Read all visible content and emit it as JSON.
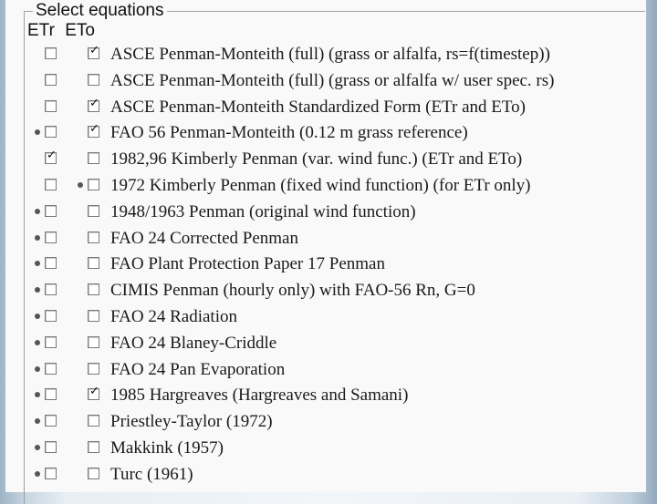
{
  "group": {
    "title": "Select equations",
    "col_etr": "ETr",
    "col_eto": "ETo"
  },
  "equations": [
    {
      "label": "ASCE Penman-Monteith (full) (grass or alfalfa, rs=f(timestep))",
      "etr_checked": false,
      "eto_checked": true,
      "etr_dot": false,
      "eto_dot": false
    },
    {
      "label": "ASCE Penman-Monteith (full) (grass or alfalfa w/ user spec. rs)",
      "etr_checked": false,
      "eto_checked": false,
      "etr_dot": false,
      "eto_dot": false
    },
    {
      "label": "ASCE Penman-Monteith Standardized Form (ETr and ETo)",
      "etr_checked": false,
      "eto_checked": true,
      "etr_dot": false,
      "eto_dot": false
    },
    {
      "label": "FAO 56 Penman-Monteith (0.12 m grass reference)",
      "etr_checked": false,
      "eto_checked": true,
      "etr_dot": true,
      "eto_dot": false
    },
    {
      "label": "1982,96 Kimberly Penman (var. wind func.) (ETr and ETo)",
      "etr_checked": true,
      "eto_checked": false,
      "etr_dot": false,
      "eto_dot": false
    },
    {
      "label": "1972 Kimberly Penman (fixed wind function) (for ETr only)",
      "etr_checked": false,
      "eto_checked": false,
      "etr_dot": false,
      "eto_dot": true
    },
    {
      "label": "1948/1963 Penman (original wind function)",
      "etr_checked": false,
      "eto_checked": false,
      "etr_dot": true,
      "eto_dot": false
    },
    {
      "label": "FAO 24 Corrected Penman",
      "etr_checked": false,
      "eto_checked": false,
      "etr_dot": true,
      "eto_dot": false
    },
    {
      "label": "FAO Plant Protection Paper 17 Penman",
      "etr_checked": false,
      "eto_checked": false,
      "etr_dot": true,
      "eto_dot": false
    },
    {
      "label": "CIMIS Penman (hourly only) with FAO-56 Rn, G=0",
      "etr_checked": false,
      "eto_checked": false,
      "etr_dot": true,
      "eto_dot": false
    },
    {
      "label": "FAO 24  Radiation",
      "etr_checked": false,
      "eto_checked": false,
      "etr_dot": true,
      "eto_dot": false
    },
    {
      "label": "FAO 24  Blaney-Criddle",
      "etr_checked": false,
      "eto_checked": false,
      "etr_dot": true,
      "eto_dot": false
    },
    {
      "label": "FAO 24  Pan Evaporation",
      "etr_checked": false,
      "eto_checked": false,
      "etr_dot": true,
      "eto_dot": false
    },
    {
      "label": "1985 Hargreaves (Hargreaves and Samani)",
      "etr_checked": false,
      "eto_checked": true,
      "etr_dot": true,
      "eto_dot": false
    },
    {
      "label": "Priestley-Taylor (1972)",
      "etr_checked": false,
      "eto_checked": false,
      "etr_dot": true,
      "eto_dot": false
    },
    {
      "label": "Makkink (1957)",
      "etr_checked": false,
      "eto_checked": false,
      "etr_dot": true,
      "eto_dot": false
    },
    {
      "label": "Turc (1961)",
      "etr_checked": false,
      "eto_checked": false,
      "etr_dot": true,
      "eto_dot": false
    }
  ]
}
